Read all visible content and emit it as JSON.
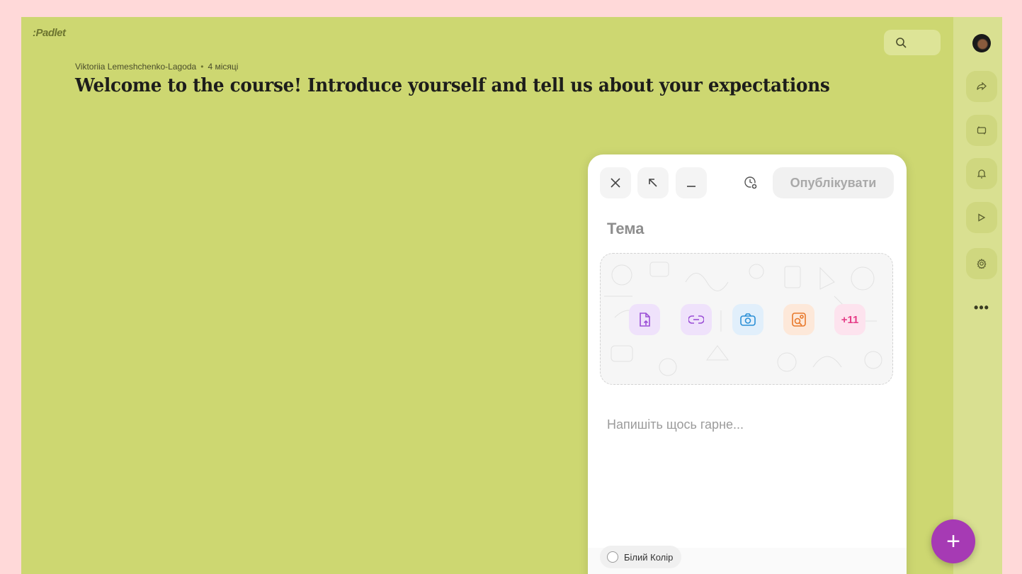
{
  "brand": {
    "logo_text": ":Padlet"
  },
  "board": {
    "author": "Viktoriia Lemeshchenko-Lagoda",
    "time_ago": "4 місяці",
    "title": "Welcome to the course! Introduce yourself and tell us about your expectations",
    "background_color": "#cdd771"
  },
  "search": {
    "icon": "search-icon"
  },
  "rail": {
    "items": [
      {
        "name": "share",
        "icon": "share-arrow-icon"
      },
      {
        "name": "remake",
        "icon": "remake-icon"
      },
      {
        "name": "notifications",
        "icon": "bell-icon"
      },
      {
        "name": "slideshow",
        "icon": "play-icon"
      },
      {
        "name": "settings",
        "icon": "gear-icon"
      }
    ],
    "more_label": "•••"
  },
  "composer": {
    "publish_label": "Опублікувати",
    "subject_placeholder": "Тема",
    "body_placeholder": "Напишіть щось гарне...",
    "attachments": [
      {
        "name": "upload",
        "icon": "file-upload-icon",
        "color": "#9b4fd6",
        "bg": "#efe2fb"
      },
      {
        "name": "link",
        "icon": "link-icon",
        "color": "#9b4fd6",
        "bg": "#efe2fb"
      },
      {
        "name": "camera",
        "icon": "camera-icon",
        "color": "#2a8fd6",
        "bg": "#e1effb"
      },
      {
        "name": "image-search",
        "icon": "image-search-icon",
        "color": "#e8782a",
        "bg": "#fde8d9"
      },
      {
        "name": "more",
        "label": "+11",
        "color": "#e53d87",
        "bg": "#fde3ee"
      }
    ],
    "color_label": "Білий Колір"
  },
  "fab": {
    "label": "+",
    "color": "#a63ab4"
  }
}
